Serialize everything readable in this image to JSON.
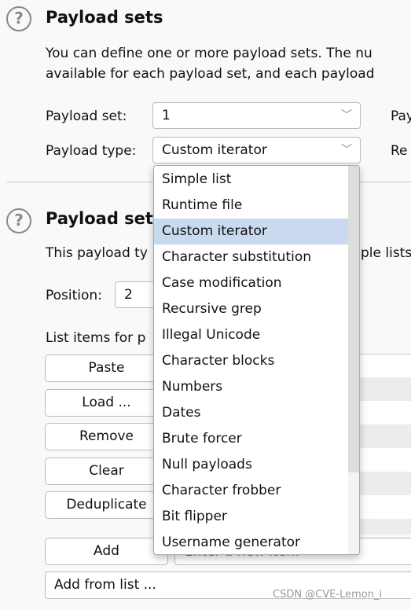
{
  "sets": {
    "title": "Payload sets",
    "desc1": "You can define one or more payload sets. The nu",
    "desc2": "available for each payload set, and each payload",
    "set_label": "Payload set:",
    "set_value": "1",
    "type_label": "Payload type:",
    "type_value": "Custom iterator",
    "right1": "Pay",
    "right2": "Re"
  },
  "settings": {
    "title": "Payload sett",
    "desc_left": "This payload ty",
    "desc_right": "ple lists",
    "position_label": "Position:",
    "position_value": "2",
    "list_label": "List items for p"
  },
  "buttons": {
    "paste": "Paste",
    "load": "Load ...",
    "remove": "Remove",
    "clear": "Clear",
    "dedup": "Deduplicate",
    "add": "Add",
    "add_from_list": "Add from list ..."
  },
  "new_item_placeholder": "Enter a new item",
  "menu": {
    "selected": "Custom iterator",
    "items": [
      "Simple list",
      "Runtime file",
      "Custom iterator",
      "Character substitution",
      "Case modification",
      "Recursive grep",
      "Illegal Unicode",
      "Character blocks",
      "Numbers",
      "Dates",
      "Brute forcer",
      "Null payloads",
      "Character frobber",
      "Bit flipper",
      "Username generator"
    ]
  },
  "watermark": "CSDN @CVE-Lemon_i"
}
